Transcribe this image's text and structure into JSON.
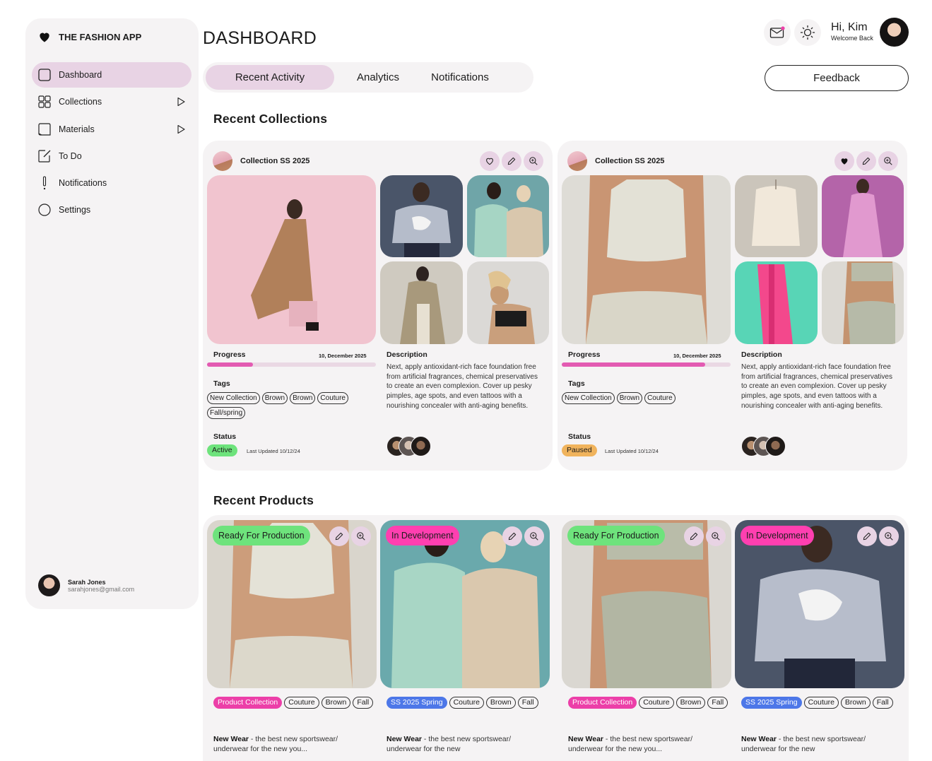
{
  "app": {
    "name": "THE FASHION APP"
  },
  "sidebar": {
    "items": [
      {
        "label": "Dashboard",
        "icon": "square-icon"
      },
      {
        "label": "Collections",
        "icon": "grid-icon"
      },
      {
        "label": "Materials",
        "icon": "folded-square-icon"
      },
      {
        "label": "To Do",
        "icon": "note-pencil-icon"
      },
      {
        "label": "Notifications",
        "icon": "exclamation-icon"
      },
      {
        "label": "Settings",
        "icon": "circle-icon"
      }
    ],
    "user": {
      "name": "Sarah Jones",
      "email": "sarahjones@gmail.com"
    }
  },
  "header": {
    "title": "DASHBOARD",
    "greeting": "Hi, Kim",
    "subgreeting": "Welcome Back",
    "feedback_label": "Feedback"
  },
  "tabs": [
    "Recent Activity",
    "Analytics",
    "Notifications"
  ],
  "sections": {
    "collections": "Recent Collections",
    "products": "Recent Products"
  },
  "collections": [
    {
      "title": "Collection SS 2025",
      "progress_label": "Progress",
      "date": "10, December 2025",
      "progress": 0.27,
      "tags_label": "Tags",
      "tags": [
        "New Collection",
        "Brown",
        "Brown",
        "Couture",
        "Fall/spring"
      ],
      "status_label": "Status",
      "status": "Active",
      "updated": "Last Updated 10/12/24",
      "desc_label": "Description",
      "description": "Next, apply antioxidant-rich face foundation free from artificial fragrances, chemical preservatives to create an even complexion. Cover up pesky pimples, age spots, and even tattoos with a nourishing concealer with anti-aging benefits.",
      "favorited": false
    },
    {
      "title": "Collection SS 2025",
      "progress_label": "Progress",
      "date": "10, December 2025",
      "progress": 0.85,
      "tags_label": "Tags",
      "tags": [
        "New Collection",
        "Brown",
        "Couture"
      ],
      "status_label": "Status",
      "status": "Paused",
      "updated": "Last Updated 10/12/24",
      "desc_label": "Description",
      "description": "Next, apply antioxidant-rich face foundation free from artificial fragrances, chemical preservatives to create an even complexion. Cover up pesky pimples, age spots, and even tattoos with a nourishing concealer with anti-aging benefits.",
      "favorited": true
    }
  ],
  "products": [
    {
      "badge": "Ready For Production",
      "tags": [
        "Product Collection",
        "Couture",
        "Brown",
        "Fall"
      ],
      "name": "New Wear",
      "desc": " - the best new sportswear/ underwear for the new you..."
    },
    {
      "badge": "In Development",
      "tags": [
        "SS 2025 Spring",
        "Couture",
        "Brown",
        "Fall"
      ],
      "name": "New Wear",
      "desc": " - the best new sportswear/ underwear for the new"
    },
    {
      "badge": "Ready For Production",
      "tags": [
        "Product Collection",
        "Couture",
        "Brown",
        "Fall"
      ],
      "name": "New Wear",
      "desc": " - the best new sportswear/ underwear for the new you..."
    },
    {
      "badge": "In Development",
      "tags": [
        "SS 2025 Spring",
        "Couture",
        "Brown",
        "Fall"
      ],
      "name": "New Wear",
      "desc": " - the best new sportswear/ underwear for the new"
    }
  ],
  "colors": {
    "accent": "#e8d3e4",
    "progress": "#e35bb2",
    "active": "#6ee37c",
    "paused": "#f0b35c",
    "ready": "#6ee37c",
    "in_dev": "#ff3fb0",
    "tag_pink": "#ec3fa8",
    "tag_blue": "#4d77e8"
  }
}
